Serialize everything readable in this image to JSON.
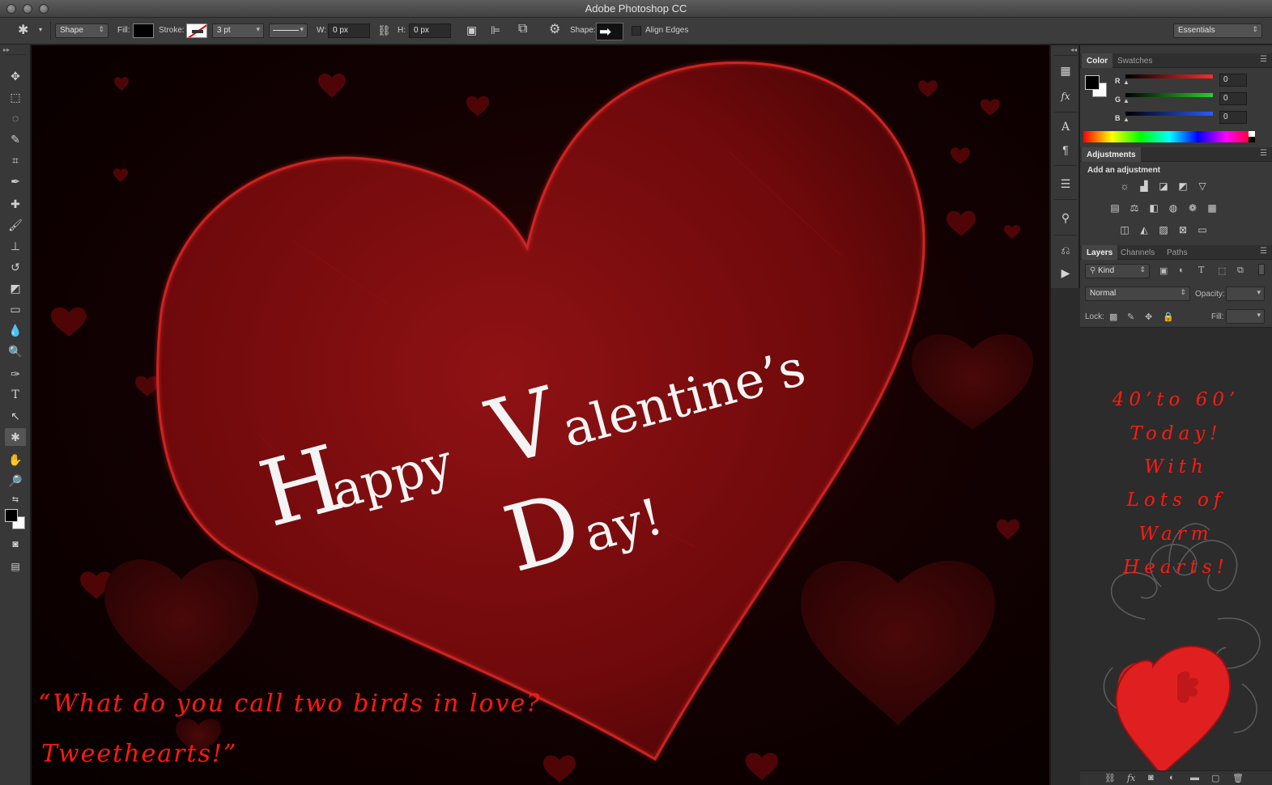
{
  "window": {
    "title": "Adobe Photoshop CC"
  },
  "options_bar": {
    "mode": "Shape",
    "fill_label": "Fill:",
    "stroke_label": "Stroke:",
    "stroke_width": "3 pt",
    "w_label": "W:",
    "w_value": "0 px",
    "h_label": "H:",
    "h_value": "0 px",
    "shape_label": "Shape:",
    "align_edges": "Align Edges",
    "workspace": "Essentials"
  },
  "color_panel": {
    "tabs": [
      "Color",
      "Swatches"
    ],
    "channels": [
      {
        "label": "R",
        "value": "0",
        "color": "#ff2a2a"
      },
      {
        "label": "G",
        "value": "0",
        "color": "#2ad02a"
      },
      {
        "label": "B",
        "value": "0",
        "color": "#2a5bff"
      }
    ]
  },
  "adjustments_panel": {
    "tab": "Adjustments",
    "heading": "Add an adjustment"
  },
  "layers_panel": {
    "tabs": [
      "Layers",
      "Channels",
      "Paths"
    ],
    "filter": "Kind",
    "blend_mode": "Normal",
    "opacity_label": "Opacity:",
    "lock_label": "Lock:",
    "fill_label": "Fill:"
  },
  "canvas": {
    "headline_line1_cap1": "H",
    "headline_line1_rest1": "appy ",
    "headline_line1_cap2": "V",
    "headline_line1_rest2": "alentine’s",
    "headline_line2_cap": "D",
    "headline_line2_rest": "ay!",
    "quote_line1": "“What do you call two birds in love?",
    "quote_line2": "Tweethearts!”"
  },
  "promo": {
    "lines": [
      "40’to 60’",
      "Today!",
      "With",
      "Lots of",
      "Warm",
      "Hearts!"
    ]
  },
  "colors": {
    "accent_red": "#ff1a10",
    "heart_red": "#8a0c0e"
  }
}
